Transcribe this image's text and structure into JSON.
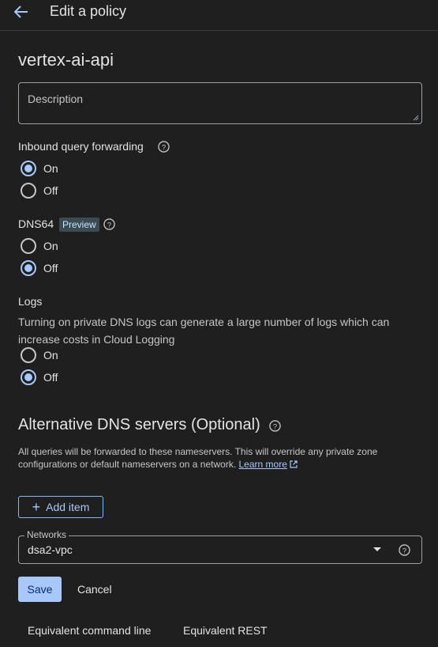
{
  "header": {
    "title": "Edit a policy",
    "back_icon": "arrow-back-icon"
  },
  "policy": {
    "name": "vertex-ai-api"
  },
  "description": {
    "placeholder": "Description",
    "value": ""
  },
  "inbound": {
    "label": "Inbound query forwarding",
    "options": [
      {
        "label": "On",
        "checked": true
      },
      {
        "label": "Off",
        "checked": false
      }
    ]
  },
  "dns64": {
    "label": "DNS64",
    "badge": "Preview",
    "options": [
      {
        "label": "On",
        "checked": false
      },
      {
        "label": "Off",
        "checked": true
      }
    ]
  },
  "logs": {
    "label": "Logs",
    "description": "Turning on private DNS logs can generate a large number of logs which can increase costs in Cloud Logging",
    "options": [
      {
        "label": "On",
        "checked": false
      },
      {
        "label": "Off",
        "checked": true
      }
    ]
  },
  "alt_dns": {
    "title": "Alternative DNS servers (Optional)",
    "description": "All queries will be forwarded to these nameservers. This will override any private zone configurations or default nameservers on a network.",
    "learn_more": "Learn more",
    "add_item": "Add item"
  },
  "networks": {
    "label": "Networks",
    "value": "dsa2-vpc"
  },
  "actions": {
    "save": "Save",
    "cancel": "Cancel"
  },
  "footer": {
    "command_line": "Equivalent command line",
    "rest": "Equivalent REST"
  },
  "colors": {
    "accent": "#a8c7fa",
    "background": "#1f1f1f"
  }
}
